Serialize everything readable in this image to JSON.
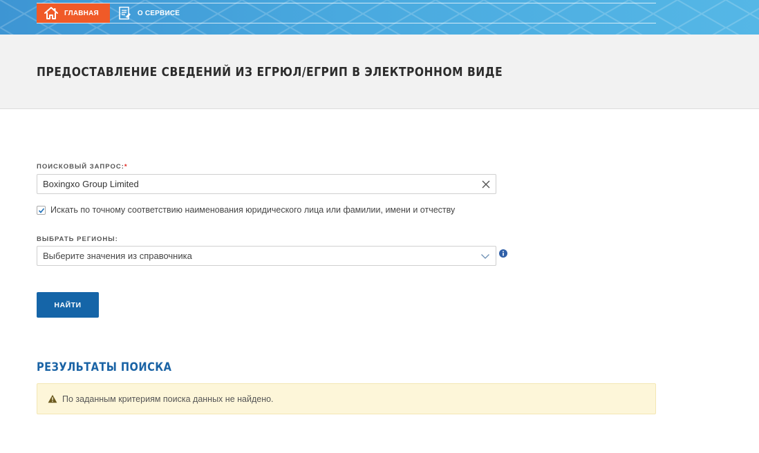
{
  "nav": {
    "items": [
      {
        "label": "ГЛАВНАЯ",
        "icon": "home-icon",
        "active": true
      },
      {
        "label": "О СЕРВИСЕ",
        "icon": "document-icon",
        "active": false
      }
    ]
  },
  "page": {
    "title": "ПРЕДОСТАВЛЕНИЕ СВЕДЕНИЙ ИЗ ЕГРЮЛ/ЕГРИП В ЭЛЕКТРОННОМ ВИДЕ"
  },
  "form": {
    "query_label": "ПОИСКОВЫЙ ЗАПРОС:",
    "required_mark": "*",
    "query_value": "Boxingxo Group Limited",
    "exact_match_checked": true,
    "exact_match_label": "Искать по точному соответствию наименования юридического лица или фамилии, имени и отчеству",
    "regions_label": "ВЫБРАТЬ РЕГИОНЫ:",
    "regions_placeholder": "Выберите значения из справочника",
    "search_button": "НАЙТИ"
  },
  "results": {
    "title": "РЕЗУЛЬТАТЫ ПОИСКА",
    "message": "По заданным критериям поиска данных не найдено."
  },
  "colors": {
    "accent": "#1565a8",
    "nav_active": "#f05a28",
    "alert_bg": "#fdf6d9",
    "required": "#e0231c"
  }
}
